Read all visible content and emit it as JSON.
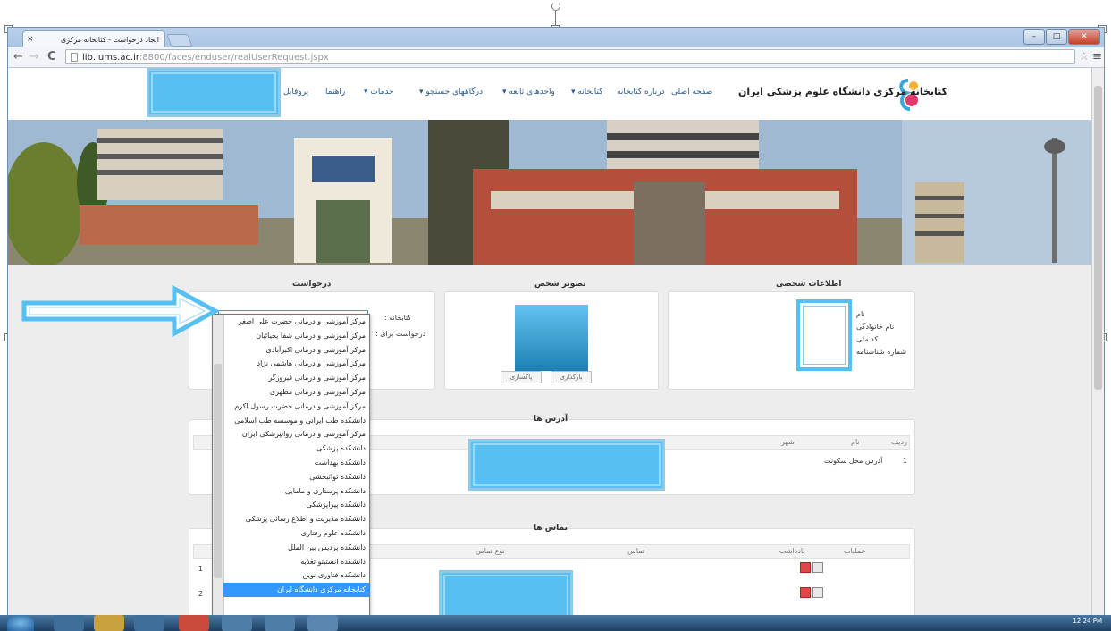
{
  "browser": {
    "tab_title": "ایجاد درخواست - کتابخانه مرکزی",
    "tab_close": "×",
    "url_host": "lib.iums.ac.ir",
    "url_path": ":8800/faces/enduser/realUserRequest.jspx",
    "nav_back": "←",
    "nav_forward": "→",
    "nav_reload": "C",
    "star": "☆",
    "menu": "≡",
    "win_min": "–",
    "win_max": "□",
    "win_close": "✕"
  },
  "site": {
    "title": "کتابخانه مرکزی دانشگاه علوم پزشکی ایران",
    "menu": [
      {
        "label": "صفحه اصلی"
      },
      {
        "label": "درباره کتابخانه"
      },
      {
        "label": "کتابخانه ▾"
      },
      {
        "label": "واحدهای تابعه ▾"
      },
      {
        "label": "درگاههای جستجو ▾"
      },
      {
        "label": "خدمات ▾"
      },
      {
        "label": "راهنما"
      },
      {
        "label": "پروفایل"
      }
    ]
  },
  "personal": {
    "title": "اطلاعات شخصی",
    "fields": [
      "نام",
      "نام خانوادگی",
      "کد ملی",
      "شماره شناسنامه"
    ]
  },
  "photo": {
    "title": "تصویر شخص",
    "upload_label": "بارگذاری",
    "delete_label": "پاکسازی"
  },
  "request": {
    "title": "درخواست",
    "library_label": "کتابخانه :",
    "request_for_label": "درخواست برای :",
    "select_value": "",
    "options": [
      "مرکز آموزشی و درمانی حضرت علی اصغر",
      "مرکز آموزشی و درمانی شفا یحیائیان",
      "مرکز آموزشی و درمانی اکبرآبادی",
      "مرکز آموزشی و درمانی هاشمی نژاد",
      "مرکز آموزشی و درمانی فیروزگر",
      "مرکز آموزشی و درمانی مطهری",
      "مرکز آموزشی و درمانی حضرت رسول اکرم",
      "دانشکده طب ایرانی و موسسه طب اسلامی",
      "مرکز آموزشی و درمانی روانپزشکی ایران",
      "دانشکده پزشکی",
      "دانشکده بهداشت",
      "دانشکده توانبخشی",
      "دانشکده پرستاری و مامایی",
      "دانشکده پیراپزشکی",
      "دانشکده مدیریت و اطلاع رسانی پزشکی",
      "دانشکده علوم رفتاری",
      "دانشکده پردیس بین الملل",
      "دانشکده انستیتو تغذیه",
      "دانشکده فناوری نوین",
      "کتابخانه مرکزی دانشگاه ایران"
    ],
    "selected_index": 19
  },
  "addresses": {
    "title": "آدرس ها",
    "headers": [
      "ردیف",
      "نام",
      "شهر"
    ],
    "rows": [
      {
        "index": "1",
        "name": "آدرس محل سکونت"
      }
    ]
  },
  "contacts": {
    "title": "تماس ها",
    "headers": [
      "عملیات",
      "یادداشت",
      "تماس",
      "نوع تماس"
    ],
    "rows": [
      {
        "index": "1"
      },
      {
        "index": "2"
      }
    ]
  },
  "taskbar": {
    "clock": "12:24 PM"
  }
}
